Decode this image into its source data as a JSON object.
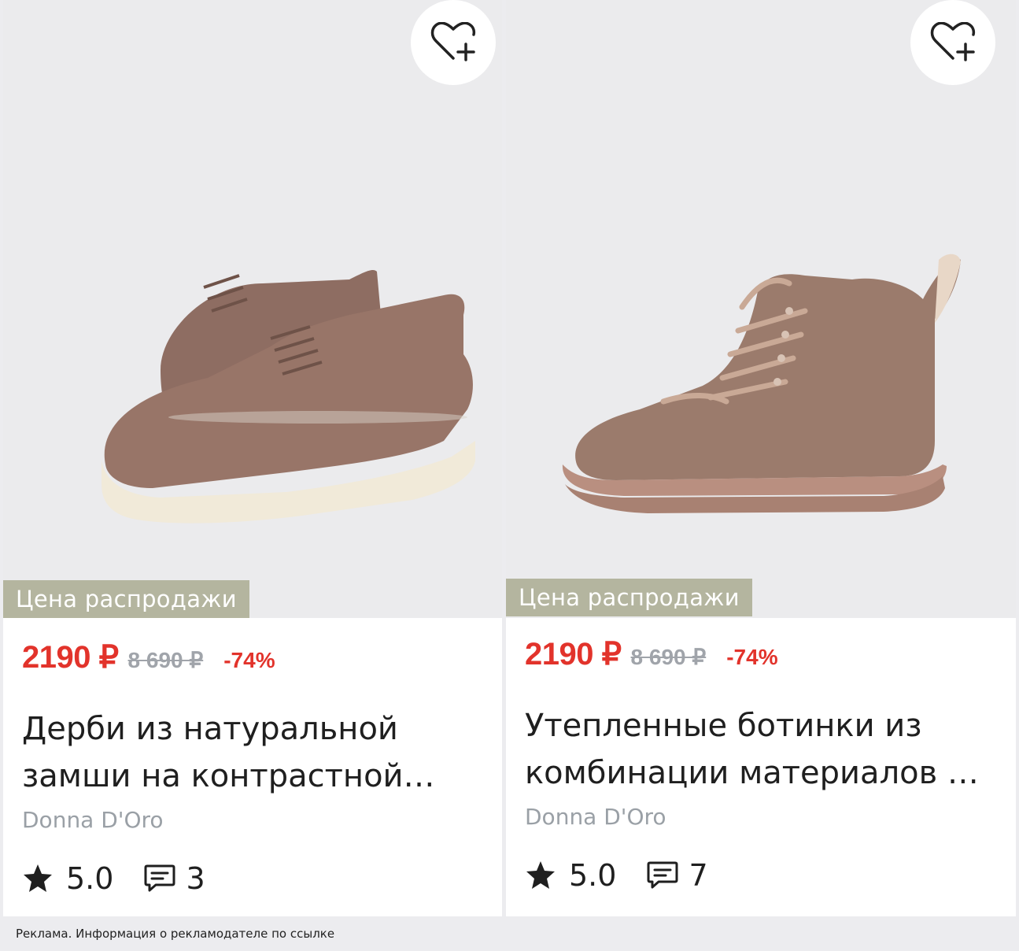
{
  "products": [
    {
      "badge": "Цена распродажи",
      "price": "2190 ₽",
      "old_price": "8 690 ₽",
      "discount": "-74%",
      "title_line1": "Дерби из натуральной",
      "title_line2": "замши на контрастной…",
      "brand": "Donna D'Oro",
      "rating": "5.0",
      "reviews": "3",
      "image_icon": "derby-shoes-image",
      "favorite_icon": "heart-plus-icon"
    },
    {
      "badge": "Цена распродажи",
      "price": "2190 ₽",
      "old_price": "8 690 ₽",
      "discount": "-74%",
      "title_line1": "Утепленные ботинки из",
      "title_line2": "комбинации материалов …",
      "brand": "Donna D'Oro",
      "rating": "5.0",
      "reviews": "7",
      "image_icon": "ankle-boot-image",
      "favorite_icon": "heart-plus-icon"
    }
  ],
  "ad_notice": "Реклама. Информация о рекламодателе по ссылке",
  "colors": {
    "price_red": "#e2332b",
    "badge_bg": "#b4b59f",
    "muted_gray": "#9aa0a6",
    "photo_bg": "#ebebed"
  }
}
